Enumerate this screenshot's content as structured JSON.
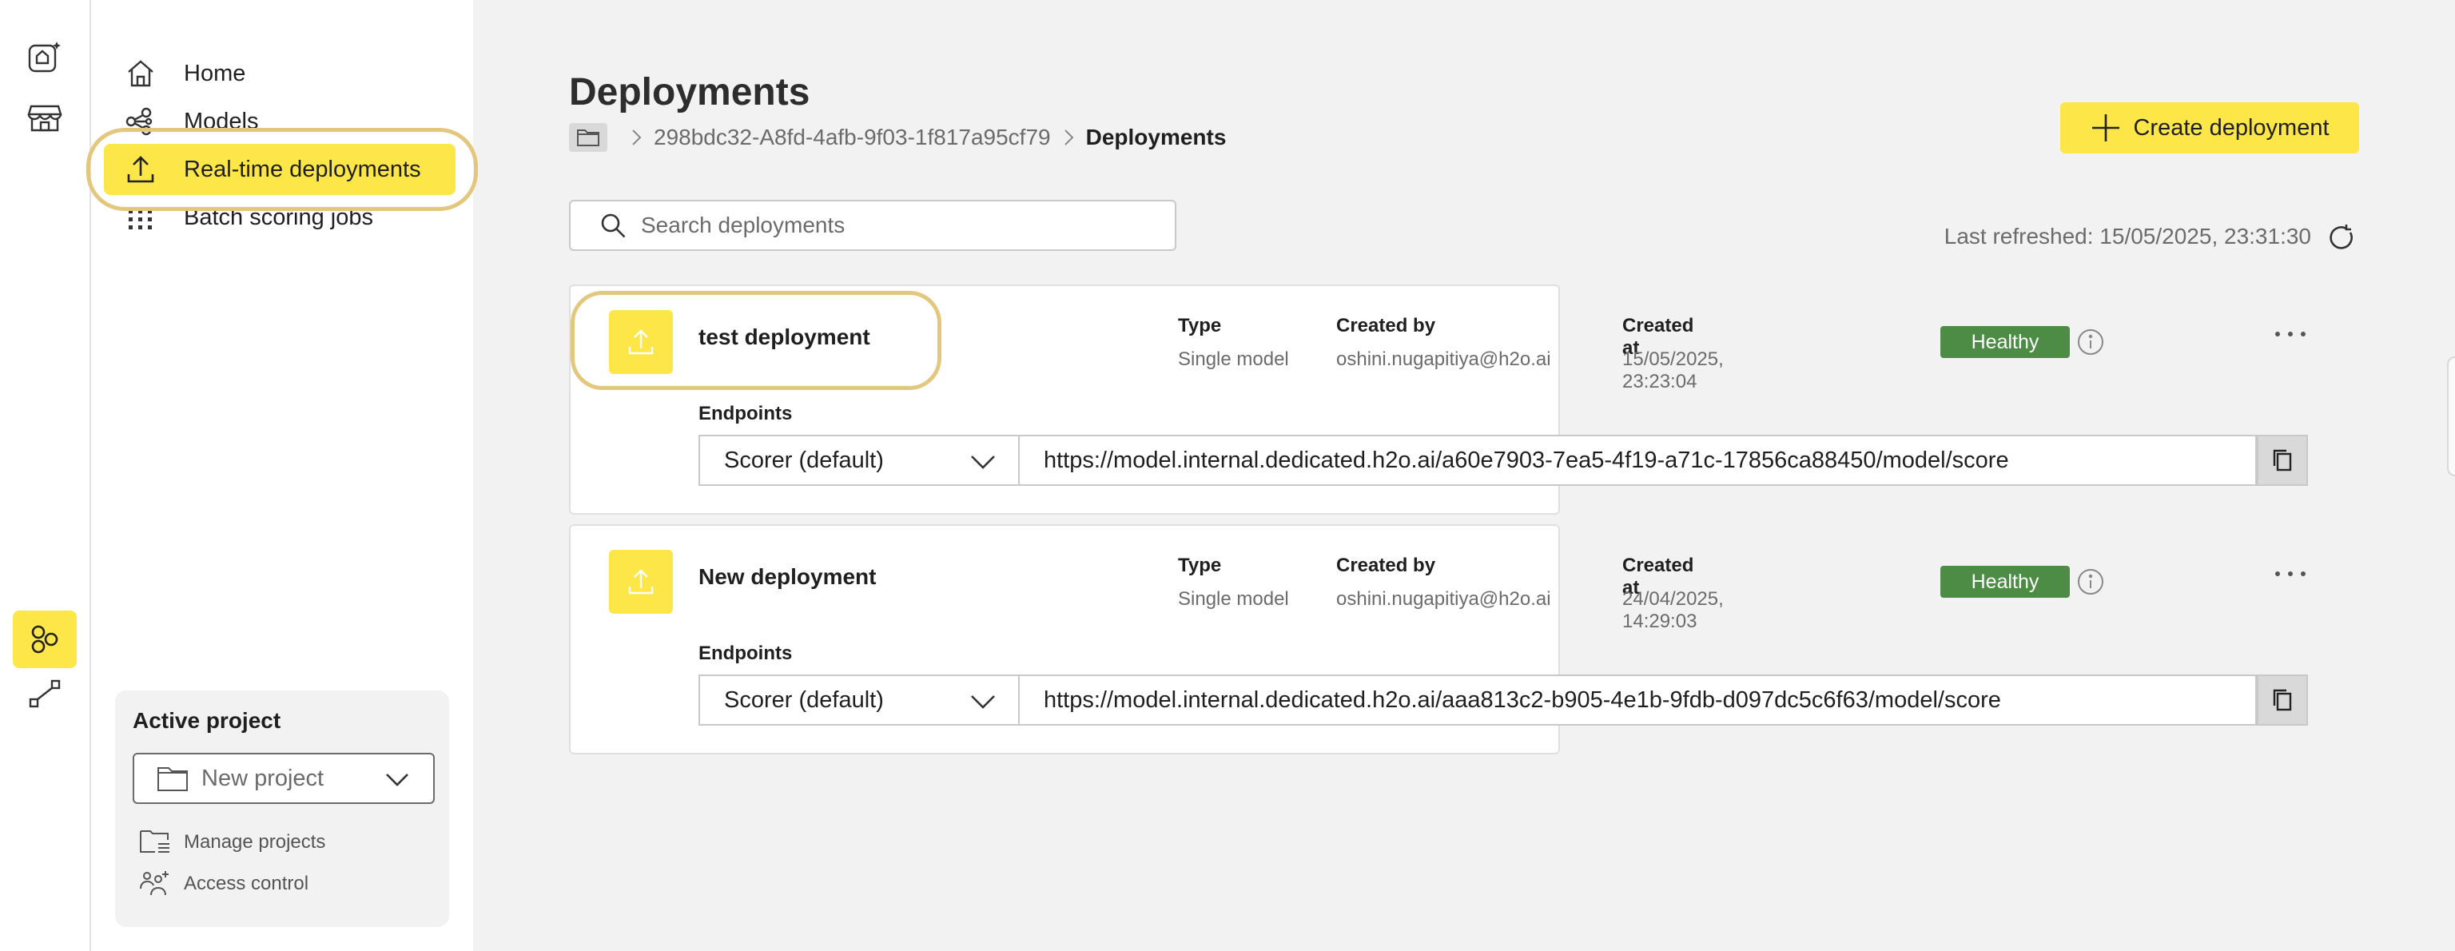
{
  "rail": {
    "items": [
      {
        "icon": "home-sparkle-icon"
      },
      {
        "icon": "storefront-icon"
      },
      {
        "icon": "models-hub-icon",
        "active": true
      },
      {
        "icon": "pipeline-icon"
      }
    ]
  },
  "sidebar": {
    "items": [
      {
        "label": "Home",
        "icon": "home-icon"
      },
      {
        "label": "Models",
        "icon": "models-icon"
      },
      {
        "label": "Real-time deployments",
        "icon": "upload-icon",
        "active": true
      },
      {
        "label": "Batch scoring jobs",
        "icon": "grid-icon"
      }
    ],
    "active_project": {
      "title": "Active project",
      "selected": "New project",
      "links": [
        {
          "label": "Manage projects",
          "icon": "manage-projects-icon"
        },
        {
          "label": "Access control",
          "icon": "access-control-icon"
        }
      ]
    }
  },
  "main": {
    "title": "Deployments",
    "breadcrumb": {
      "project_id": "298bdc32-A8fd-4afb-9f03-1f817a95cf79",
      "current": "Deployments"
    },
    "create_label": "Create deployment",
    "search_placeholder": "Search deployments",
    "last_refreshed": "Last refreshed: 15/05/2025, 23:31:30",
    "meta_labels": {
      "type": "Type",
      "created_by": "Created by",
      "created_at": "Created at",
      "endpoints": "Endpoints"
    },
    "deployments": [
      {
        "name": "test deployment",
        "type": "Single model",
        "created_by": "oshini.nugapitiya@h2o.ai",
        "created_at": "15/05/2025, 23:23:04",
        "status": "Healthy",
        "endpoint_scorer": "Scorer (default)",
        "endpoint_url": "https://model.internal.dedicated.h2o.ai/a60e7903-7ea5-4f19-a71c-17856ca88450/model/score"
      },
      {
        "name": "New deployment",
        "type": "Single model",
        "created_by": "oshini.nugapitiya@h2o.ai",
        "created_at": "24/04/2025, 14:29:03",
        "status": "Healthy",
        "endpoint_scorer": "Scorer (default)",
        "endpoint_url": "https://model.internal.dedicated.h2o.ai/aaa813c2-b905-4e1b-9fdb-d097dc5c6f63/model/score"
      }
    ]
  },
  "colors": {
    "accent": "#fde647",
    "healthy": "#4c8c44",
    "highlight_ring": "#e3c77d"
  }
}
